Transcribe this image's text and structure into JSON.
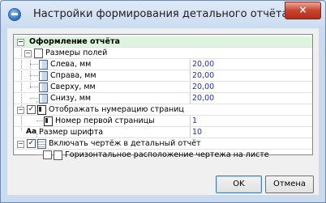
{
  "window": {
    "title": "Настройки формирования детального отчёта",
    "close_glyph": "×"
  },
  "tree": {
    "section_header": "Оформление отчёта",
    "margins_group": "Размеры полей",
    "margins": [
      {
        "label": "Слева, мм",
        "value": "20,00"
      },
      {
        "label": "Справа, мм",
        "value": "20,00"
      },
      {
        "label": "Сверху, мм",
        "value": "20,00"
      },
      {
        "label": "Снизу, мм",
        "value": "20,00"
      }
    ],
    "page_numbering": {
      "label": "Отображать нумерацию страниц",
      "checked": true
    },
    "first_page_number": {
      "label": "Номер первой страницы",
      "value": "1"
    },
    "font_size": {
      "icon_text": "Aa",
      "label": "Размер шрифта",
      "value": "10"
    },
    "include_drawing": {
      "label": "Включать чертёж в детальный отчёт",
      "checked": true
    },
    "horizontal_drawing": {
      "label": "Горизонтальное расположение чертежа на листе",
      "checked": false
    }
  },
  "buttons": {
    "ok": "OK",
    "cancel": "Отмена"
  },
  "colors": {
    "category_bg": "#dcf5dc",
    "value_text": "#1a30c8",
    "close_button": "#c7452e"
  }
}
